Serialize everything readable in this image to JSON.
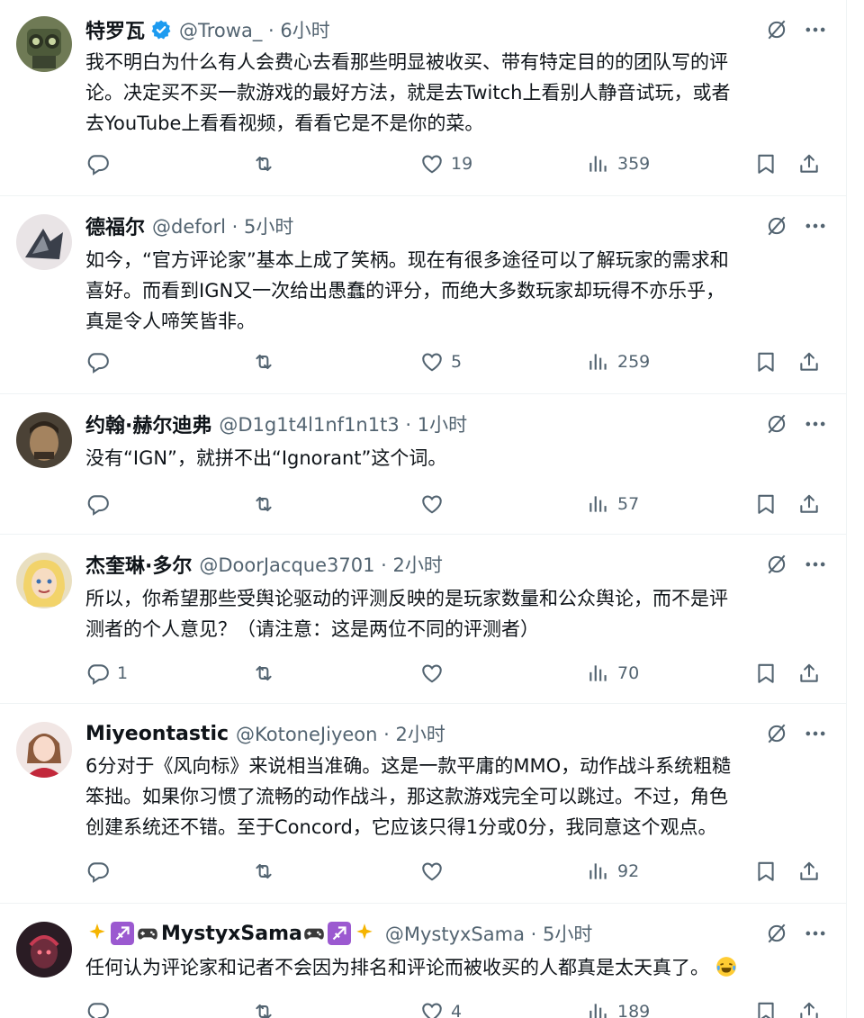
{
  "tweets": [
    {
      "name": "特罗瓦",
      "verified": true,
      "handle": "@Trowa_ · 6小时",
      "text": "我不明白为什么有人会费心去看那些明显被收买、带有特定目的的团队写的评\n论。决定买不买一款游戏的最好方法，就是去Twitch上看别人静音试玩，或者\n去YouTube上看看视频，看看它是不是你的菜。",
      "replies": "",
      "retweets": "",
      "likes": "19",
      "views": "359"
    },
    {
      "name": "德福尔",
      "verified": false,
      "handle": "@deforl · 5小时",
      "text": "如今，“官方评论家”基本上成了笑柄。现在有很多途径可以了解玩家的需求和\n喜好。而看到IGN又一次给出愚蠢的评分，而绝大多数玩家却玩得不亦乐乎，\n真是令人啼笑皆非。",
      "replies": "",
      "retweets": "",
      "likes": "5",
      "views": "259"
    },
    {
      "name": "约翰·赫尔迪弗",
      "verified": false,
      "handle": "@D1g1t4l1nf1n1t3 · 1小时",
      "text": "没有“IGN”，就拼不出“Ignorant”这个词。",
      "replies": "",
      "retweets": "",
      "likes": "",
      "views": "57"
    },
    {
      "name": "杰奎琳·多尔",
      "verified": false,
      "handle": "@DoorJacque3701 · 2小时",
      "text": "所以，你希望那些受舆论驱动的评测反映的是玩家数量和公众舆论，而不是评\n测者的个人意见？（请注意：这是两位不同的评测者）",
      "replies": "1",
      "retweets": "",
      "likes": "",
      "views": "70"
    },
    {
      "name": "Miyeontastic",
      "verified": false,
      "handle": "@KotoneJiyeon · 2小时",
      "text": "6分对于《风向标》来说相当准确。这是一款平庸的MMO，动作战斗系统粗糙\n笨拙。如果你习惯了流畅的动作战斗，那这款游戏完全可以跳过。不过，角色\n创建系统还不错。至于Concord，它应该只得1分或0分，我同意这个观点。",
      "replies": "",
      "retweets": "",
      "likes": "",
      "views": "92"
    },
    {
      "name": "MystyxSama",
      "verified": false,
      "handle": "@MystyxSama · 5小时",
      "text": "任何认为评论家和记者不会因为排名和评论而被收买的人都真是太天真了。",
      "replies": "",
      "retweets": "",
      "likes": "4",
      "views": "189"
    }
  ],
  "icons": {
    "grok": "grok-icon",
    "more": "more-icon",
    "reply": "reply-icon",
    "retweet": "retweet-icon",
    "like": "like-icon",
    "views": "views-icon",
    "bookmark": "bookmark-icon",
    "share": "share-icon"
  },
  "colors": {
    "text": "#0f1419",
    "secondary": "#536471",
    "verified": "#1d9bf0",
    "divider": "#eff3f4"
  }
}
